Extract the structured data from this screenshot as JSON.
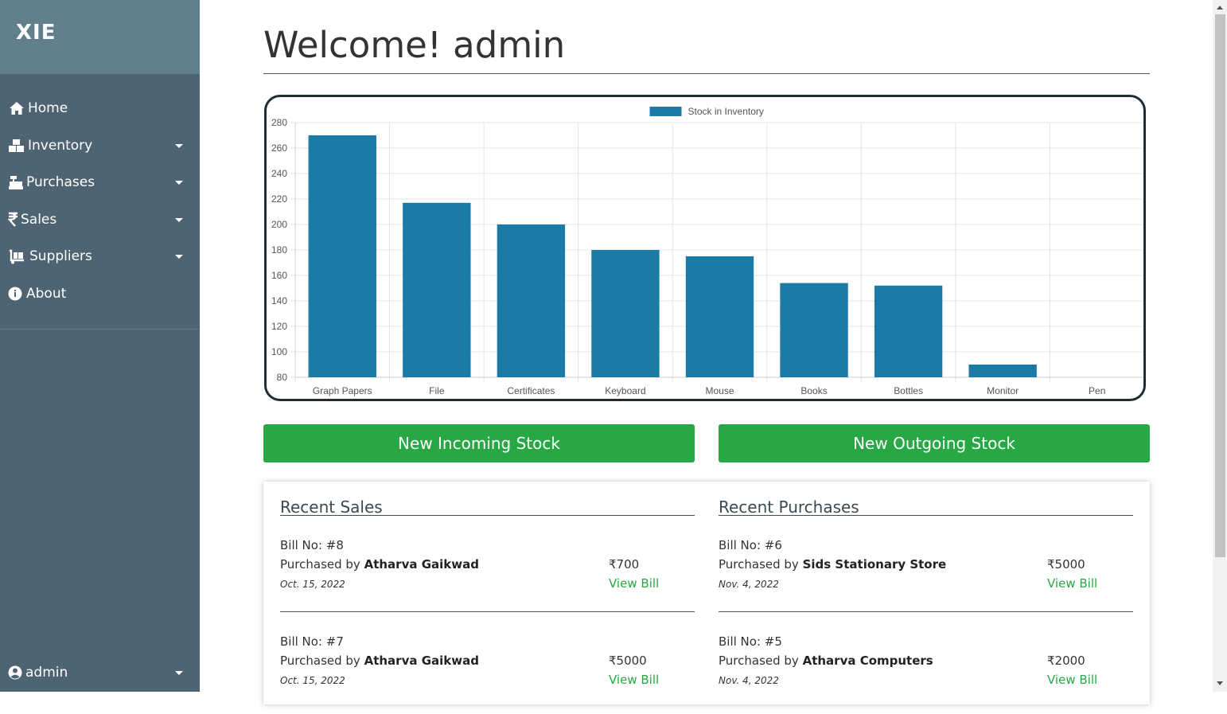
{
  "brand": {
    "logo": "XIE"
  },
  "sidebar": {
    "items": [
      {
        "label": "Home",
        "icon": "home-icon"
      },
      {
        "label": "Inventory",
        "icon": "boxes-icon"
      },
      {
        "label": "Purchases",
        "icon": "cash-register-icon"
      },
      {
        "label": "Sales",
        "icon": "rupee-icon"
      },
      {
        "label": "Suppliers",
        "icon": "dolly-icon"
      },
      {
        "label": "About",
        "icon": "info-circle-icon"
      }
    ],
    "user": {
      "label": "admin",
      "icon": "user-circle-icon"
    }
  },
  "main": {
    "title": "Welcome! admin",
    "buttons": {
      "incoming": "New Incoming Stock",
      "outgoing": "New Outgoing Stock"
    }
  },
  "chart_data": {
    "type": "bar",
    "categories": [
      "Graph Papers",
      "File",
      "Certificates",
      "Keyboard",
      "Mouse",
      "Books",
      "Bottles",
      "Monitor",
      "Pen"
    ],
    "series": [
      {
        "name": "Stock in Inventory",
        "values": [
          270,
          217,
          200,
          180,
          175,
          154,
          152,
          90,
          80
        ],
        "color": "#1c7aa7"
      }
    ],
    "ylim": [
      80,
      280
    ],
    "yticks": [
      80,
      100,
      120,
      140,
      160,
      180,
      200,
      220,
      240,
      260,
      280
    ],
    "grid": true,
    "legend": "top-center"
  },
  "recent_sales": {
    "title": "Recent Sales",
    "entries": [
      {
        "bill": "Bill No: #8",
        "prefix": "Purchased by",
        "name": "Atharva Gaikwad",
        "date": "Oct. 15, 2022",
        "amount": "₹700",
        "link": "View Bill"
      },
      {
        "bill": "Bill No: #7",
        "prefix": "Purchased by",
        "name": "Atharva Gaikwad",
        "date": "Oct. 15, 2022",
        "amount": "₹5000",
        "link": "View Bill"
      }
    ]
  },
  "recent_purchases": {
    "title": "Recent Purchases",
    "entries": [
      {
        "bill": "Bill No: #6",
        "prefix": "Purchased by",
        "name": "Sids Stationary Store",
        "date": "Nov. 4, 2022",
        "amount": "₹5000",
        "link": "View Bill"
      },
      {
        "bill": "Bill No: #5",
        "prefix": "Purchased by",
        "name": "Atharva Computers",
        "date": "Nov. 4, 2022",
        "amount": "₹2000",
        "link": "View Bill"
      }
    ]
  },
  "colors": {
    "sidebar": "#4e6472",
    "brand": "#627f8c",
    "accent": "#28a745",
    "bar": "#1c7aa7"
  }
}
